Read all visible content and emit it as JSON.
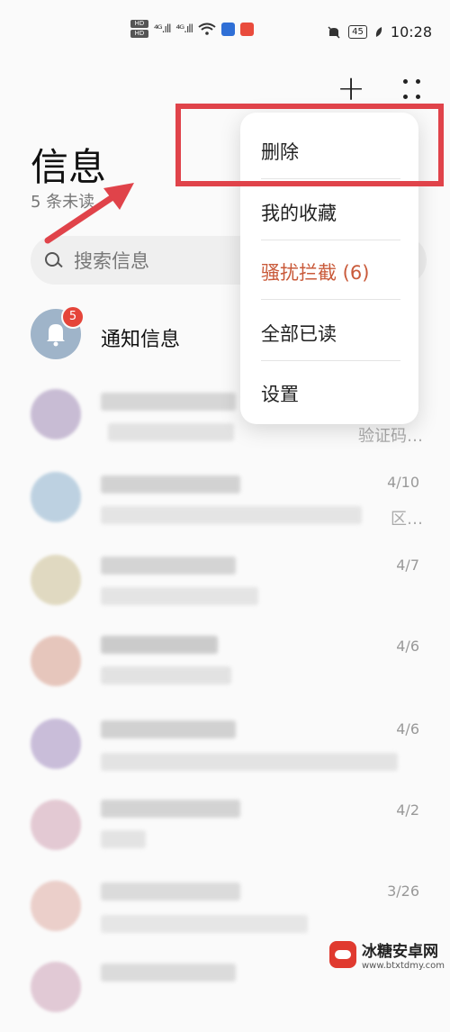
{
  "status_bar": {
    "hd_labels": [
      "HD",
      "HD"
    ],
    "signal1": "⁴ᴳ.ıll",
    "signal2": "⁴ᴳ.ıll",
    "battery": "45",
    "time": "10:28"
  },
  "header": {
    "title": "信息",
    "unread": "5 条未读"
  },
  "search": {
    "placeholder": "搜索信息"
  },
  "notification": {
    "label": "通知信息",
    "badge": "5"
  },
  "messages": [
    {
      "date": "",
      "snippet": "验证码…",
      "avatar_color": "#b8a8c8"
    },
    {
      "date": "4/10",
      "snippet": "区…",
      "avatar_color": "#a9c4d9"
    },
    {
      "date": "4/7",
      "snippet": "",
      "avatar_color": "#d8cfae"
    },
    {
      "date": "4/6",
      "snippet": "",
      "avatar_color": "#e0b5a8"
    },
    {
      "date": "4/6",
      "snippet": "",
      "avatar_color": "#b9a9cf"
    },
    {
      "date": "4/2",
      "snippet": "",
      "avatar_color": "#dcb9c6"
    },
    {
      "date": "3/26",
      "snippet": "",
      "avatar_color": "#e6c1ba"
    },
    {
      "date": "",
      "snippet": "",
      "avatar_color": "#d9b9c9"
    }
  ],
  "menu": {
    "items": [
      {
        "label": "删除"
      },
      {
        "label": "我的收藏"
      },
      {
        "label": "骚扰拦截 (6)"
      },
      {
        "label": "全部已读"
      },
      {
        "label": "设置"
      }
    ]
  },
  "colors": {
    "accent_red": "#e0434a",
    "warn_text": "#c95a3a",
    "badge": "#e5453a"
  },
  "watermark": {
    "title": "冰糖安卓网",
    "url": "www.btxtdmy.com"
  }
}
